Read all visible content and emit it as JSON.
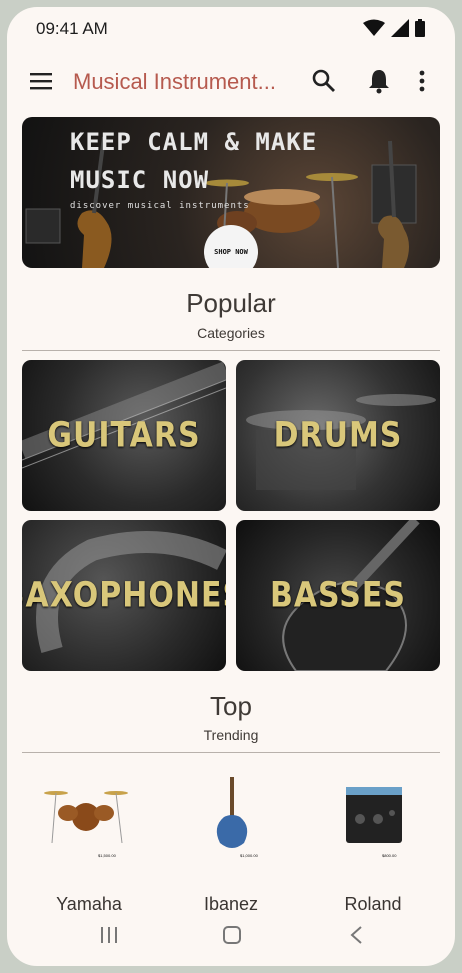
{
  "status_bar": {
    "time": "09:41 AM"
  },
  "app_bar": {
    "title": "Musical Instrument..."
  },
  "banner": {
    "headline": "KEEP CALM & MAKE\nMUSIC NOW",
    "subtext": "discover musical instruments",
    "cta": "SHOP NOW"
  },
  "popular": {
    "title": "Popular",
    "subtitle": "Categories",
    "categories": [
      {
        "label": "GUITARS"
      },
      {
        "label": "DRUMS"
      },
      {
        "label": "SAXOPHONES"
      },
      {
        "label": "BASSES"
      }
    ]
  },
  "top": {
    "title": "Top",
    "subtitle": "Trending",
    "items": [
      {
        "brand": "Yamaha",
        "price": "$1,500.00"
      },
      {
        "brand": "Ibanez",
        "price": "$1,000.00"
      },
      {
        "brand": "Roland",
        "price": "$800.00"
      }
    ]
  },
  "icons": [
    "menu-icon",
    "search-icon",
    "bell-icon",
    "more-vert-icon",
    "wifi-icon",
    "signal-icon",
    "battery-icon",
    "recents-icon",
    "home-icon",
    "back-icon"
  ],
  "colors": {
    "accent": "#b65a4e",
    "background": "#fcf7f3",
    "category_text": "#d9c77a"
  }
}
